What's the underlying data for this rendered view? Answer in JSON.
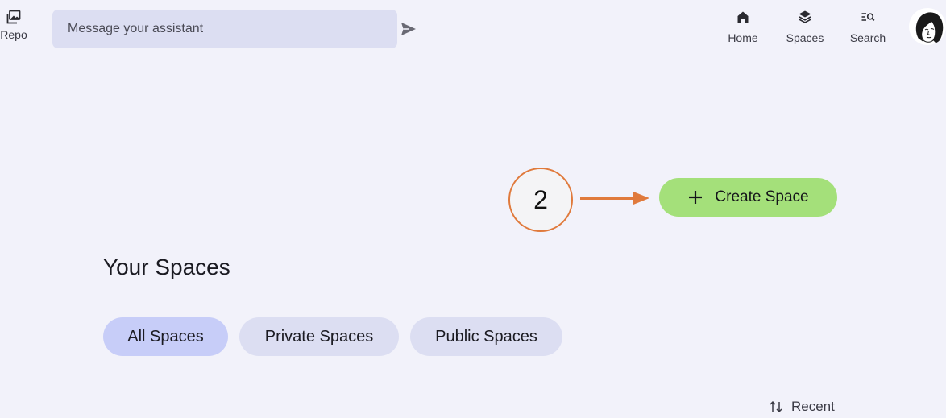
{
  "header": {
    "repo": {
      "label": "Repo",
      "icon": "gallery-icon"
    },
    "message": {
      "placeholder": "Message your assistant",
      "value": ""
    },
    "send_icon": "send-icon",
    "nav": [
      {
        "label": "Home",
        "icon": "home-icon"
      },
      {
        "label": "Spaces",
        "icon": "layers-icon"
      },
      {
        "label": "Search",
        "icon": "search-list-icon"
      }
    ],
    "avatar_icon": "user-avatar"
  },
  "annotation": {
    "step_number": "2",
    "color": "#e07a3c"
  },
  "main": {
    "create_button": {
      "label": "Create Space",
      "icon": "plus-icon",
      "color": "#a4e07a"
    },
    "title": "Your Spaces",
    "filters": [
      {
        "label": "All Spaces",
        "active": true
      },
      {
        "label": "Private Spaces",
        "active": false
      },
      {
        "label": "Public Spaces",
        "active": false
      }
    ],
    "sort": {
      "label": "Recent",
      "icon": "sort-icon"
    }
  },
  "colors": {
    "background": "#f2f2fa",
    "chip_active": "#c7cdf8",
    "chip_inactive": "#dcdef2",
    "input_bg": "#dcdef2"
  }
}
